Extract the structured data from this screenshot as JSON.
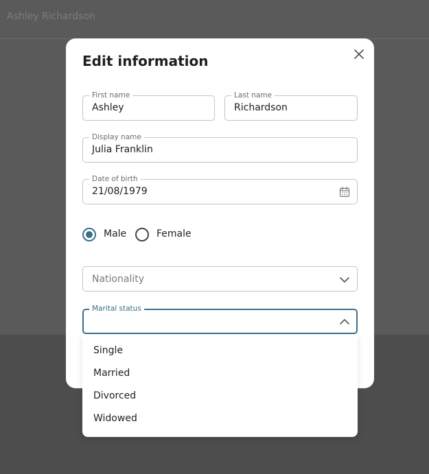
{
  "background": {
    "header_title": "Ashley Richardson"
  },
  "modal": {
    "title": "Edit information",
    "close_icon": "close-icon",
    "first_name": {
      "label": "First name",
      "value": "Ashley"
    },
    "last_name": {
      "label": "Last name",
      "value": "Richardson"
    },
    "display_name": {
      "label": "Display name",
      "value": "Julia Franklin"
    },
    "date_of_birth": {
      "label": "Date of birth",
      "value": "21/08/1979",
      "icon": "calendar-icon"
    },
    "gender": {
      "options": [
        {
          "label": "Male",
          "checked": true
        },
        {
          "label": "Female",
          "checked": false
        }
      ]
    },
    "nationality": {
      "placeholder": "Nationality",
      "icon": "chevron-down-icon"
    },
    "marital_status": {
      "label": "Marital status",
      "value": "",
      "icon": "chevron-up-icon",
      "options": [
        "Single",
        "Married",
        "Divorced",
        "Widowed"
      ]
    }
  },
  "colors": {
    "accent": "#3a6f8c",
    "overlay": "#5a5a5a",
    "border": "#c4c4c4"
  }
}
